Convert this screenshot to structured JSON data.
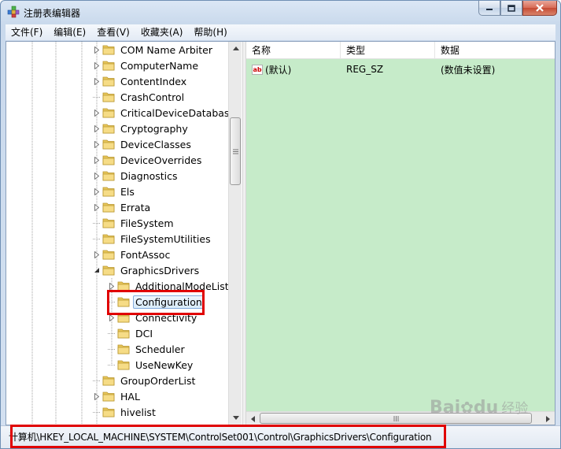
{
  "window": {
    "title": "注册表编辑器"
  },
  "menu": [
    "文件(F)",
    "编辑(E)",
    "查看(V)",
    "收藏夹(A)",
    "帮助(H)"
  ],
  "tree": {
    "items": [
      {
        "label": "COM Name Arbiter",
        "level": 1,
        "expander": "collapsed"
      },
      {
        "label": "ComputerName",
        "level": 1,
        "expander": "collapsed"
      },
      {
        "label": "ContentIndex",
        "level": 1,
        "expander": "collapsed"
      },
      {
        "label": "CrashControl",
        "level": 1,
        "expander": "none"
      },
      {
        "label": "CriticalDeviceDatabase",
        "level": 1,
        "expander": "collapsed"
      },
      {
        "label": "Cryptography",
        "level": 1,
        "expander": "collapsed"
      },
      {
        "label": "DeviceClasses",
        "level": 1,
        "expander": "collapsed"
      },
      {
        "label": "DeviceOverrides",
        "level": 1,
        "expander": "collapsed"
      },
      {
        "label": "Diagnostics",
        "level": 1,
        "expander": "collapsed"
      },
      {
        "label": "Els",
        "level": 1,
        "expander": "collapsed"
      },
      {
        "label": "Errata",
        "level": 1,
        "expander": "collapsed"
      },
      {
        "label": "FileSystem",
        "level": 1,
        "expander": "none"
      },
      {
        "label": "FileSystemUtilities",
        "level": 1,
        "expander": "none"
      },
      {
        "label": "FontAssoc",
        "level": 1,
        "expander": "collapsed"
      },
      {
        "label": "GraphicsDrivers",
        "level": 1,
        "expander": "expanded"
      },
      {
        "label": "AdditionalModeLists",
        "level": 2,
        "expander": "collapsed"
      },
      {
        "label": "Configuration",
        "level": 2,
        "expander": "none",
        "selected": true
      },
      {
        "label": "Connectivity",
        "level": 2,
        "expander": "collapsed"
      },
      {
        "label": "DCI",
        "level": 2,
        "expander": "none"
      },
      {
        "label": "Scheduler",
        "level": 2,
        "expander": "none"
      },
      {
        "label": "UseNewKey",
        "level": 2,
        "expander": "none"
      },
      {
        "label": "GroupOrderList",
        "level": 1,
        "expander": "none"
      },
      {
        "label": "HAL",
        "level": 1,
        "expander": "collapsed"
      },
      {
        "label": "hivelist",
        "level": 1,
        "expander": "none"
      }
    ]
  },
  "values": {
    "columns": [
      "名称",
      "类型",
      "数据"
    ],
    "rows": [
      {
        "name": "(默认)",
        "type": "REG_SZ",
        "data": "(数值未设置)",
        "icon": "string-value-icon"
      }
    ]
  },
  "status": {
    "path": "计算机\\HKEY_LOCAL_MACHINE\\SYSTEM\\ControlSet001\\Control\\GraphicsDrivers\\Configuration"
  },
  "colors": {
    "value_pane_bg": "#c6ebc9",
    "highlight_box": "#e00000",
    "selection_border": "#84acdd"
  },
  "watermark": {
    "brand": "Bai",
    "mid": "du",
    "sub": "经验"
  }
}
